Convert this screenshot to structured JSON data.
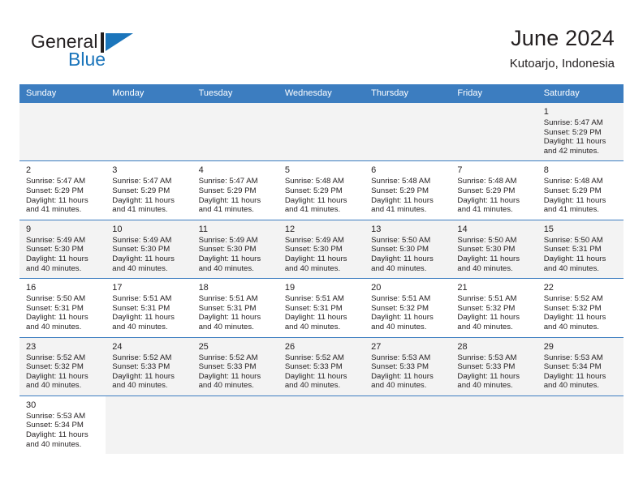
{
  "brand": {
    "name_top": "General",
    "name_bottom": "Blue",
    "accent_color": "#1b75bb",
    "flag_icon": "flag-icon"
  },
  "header": {
    "title": "June 2024",
    "subtitle": "Kutoarjo, Indonesia"
  },
  "calendar": {
    "header_bg": "#3c7dc0",
    "shade_bg": "#f3f3f3",
    "weekdays": [
      "Sunday",
      "Monday",
      "Tuesday",
      "Wednesday",
      "Thursday",
      "Friday",
      "Saturday"
    ],
    "weeks": [
      [
        {
          "empty": true
        },
        {
          "empty": true
        },
        {
          "empty": true
        },
        {
          "empty": true
        },
        {
          "empty": true
        },
        {
          "empty": true
        },
        {
          "day": "1",
          "sunrise": "Sunrise: 5:47 AM",
          "sunset": "Sunset: 5:29 PM",
          "daylight1": "Daylight: 11 hours",
          "daylight2": "and 42 minutes."
        }
      ],
      [
        {
          "day": "2",
          "sunrise": "Sunrise: 5:47 AM",
          "sunset": "Sunset: 5:29 PM",
          "daylight1": "Daylight: 11 hours",
          "daylight2": "and 41 minutes."
        },
        {
          "day": "3",
          "sunrise": "Sunrise: 5:47 AM",
          "sunset": "Sunset: 5:29 PM",
          "daylight1": "Daylight: 11 hours",
          "daylight2": "and 41 minutes."
        },
        {
          "day": "4",
          "sunrise": "Sunrise: 5:47 AM",
          "sunset": "Sunset: 5:29 PM",
          "daylight1": "Daylight: 11 hours",
          "daylight2": "and 41 minutes."
        },
        {
          "day": "5",
          "sunrise": "Sunrise: 5:48 AM",
          "sunset": "Sunset: 5:29 PM",
          "daylight1": "Daylight: 11 hours",
          "daylight2": "and 41 minutes."
        },
        {
          "day": "6",
          "sunrise": "Sunrise: 5:48 AM",
          "sunset": "Sunset: 5:29 PM",
          "daylight1": "Daylight: 11 hours",
          "daylight2": "and 41 minutes."
        },
        {
          "day": "7",
          "sunrise": "Sunrise: 5:48 AM",
          "sunset": "Sunset: 5:29 PM",
          "daylight1": "Daylight: 11 hours",
          "daylight2": "and 41 minutes."
        },
        {
          "day": "8",
          "sunrise": "Sunrise: 5:48 AM",
          "sunset": "Sunset: 5:29 PM",
          "daylight1": "Daylight: 11 hours",
          "daylight2": "and 41 minutes."
        }
      ],
      [
        {
          "day": "9",
          "sunrise": "Sunrise: 5:49 AM",
          "sunset": "Sunset: 5:30 PM",
          "daylight1": "Daylight: 11 hours",
          "daylight2": "and 40 minutes."
        },
        {
          "day": "10",
          "sunrise": "Sunrise: 5:49 AM",
          "sunset": "Sunset: 5:30 PM",
          "daylight1": "Daylight: 11 hours",
          "daylight2": "and 40 minutes."
        },
        {
          "day": "11",
          "sunrise": "Sunrise: 5:49 AM",
          "sunset": "Sunset: 5:30 PM",
          "daylight1": "Daylight: 11 hours",
          "daylight2": "and 40 minutes."
        },
        {
          "day": "12",
          "sunrise": "Sunrise: 5:49 AM",
          "sunset": "Sunset: 5:30 PM",
          "daylight1": "Daylight: 11 hours",
          "daylight2": "and 40 minutes."
        },
        {
          "day": "13",
          "sunrise": "Sunrise: 5:50 AM",
          "sunset": "Sunset: 5:30 PM",
          "daylight1": "Daylight: 11 hours",
          "daylight2": "and 40 minutes."
        },
        {
          "day": "14",
          "sunrise": "Sunrise: 5:50 AM",
          "sunset": "Sunset: 5:30 PM",
          "daylight1": "Daylight: 11 hours",
          "daylight2": "and 40 minutes."
        },
        {
          "day": "15",
          "sunrise": "Sunrise: 5:50 AM",
          "sunset": "Sunset: 5:31 PM",
          "daylight1": "Daylight: 11 hours",
          "daylight2": "and 40 minutes."
        }
      ],
      [
        {
          "day": "16",
          "sunrise": "Sunrise: 5:50 AM",
          "sunset": "Sunset: 5:31 PM",
          "daylight1": "Daylight: 11 hours",
          "daylight2": "and 40 minutes."
        },
        {
          "day": "17",
          "sunrise": "Sunrise: 5:51 AM",
          "sunset": "Sunset: 5:31 PM",
          "daylight1": "Daylight: 11 hours",
          "daylight2": "and 40 minutes."
        },
        {
          "day": "18",
          "sunrise": "Sunrise: 5:51 AM",
          "sunset": "Sunset: 5:31 PM",
          "daylight1": "Daylight: 11 hours",
          "daylight2": "and 40 minutes."
        },
        {
          "day": "19",
          "sunrise": "Sunrise: 5:51 AM",
          "sunset": "Sunset: 5:31 PM",
          "daylight1": "Daylight: 11 hours",
          "daylight2": "and 40 minutes."
        },
        {
          "day": "20",
          "sunrise": "Sunrise: 5:51 AM",
          "sunset": "Sunset: 5:32 PM",
          "daylight1": "Daylight: 11 hours",
          "daylight2": "and 40 minutes."
        },
        {
          "day": "21",
          "sunrise": "Sunrise: 5:51 AM",
          "sunset": "Sunset: 5:32 PM",
          "daylight1": "Daylight: 11 hours",
          "daylight2": "and 40 minutes."
        },
        {
          "day": "22",
          "sunrise": "Sunrise: 5:52 AM",
          "sunset": "Sunset: 5:32 PM",
          "daylight1": "Daylight: 11 hours",
          "daylight2": "and 40 minutes."
        }
      ],
      [
        {
          "day": "23",
          "sunrise": "Sunrise: 5:52 AM",
          "sunset": "Sunset: 5:32 PM",
          "daylight1": "Daylight: 11 hours",
          "daylight2": "and 40 minutes."
        },
        {
          "day": "24",
          "sunrise": "Sunrise: 5:52 AM",
          "sunset": "Sunset: 5:33 PM",
          "daylight1": "Daylight: 11 hours",
          "daylight2": "and 40 minutes."
        },
        {
          "day": "25",
          "sunrise": "Sunrise: 5:52 AM",
          "sunset": "Sunset: 5:33 PM",
          "daylight1": "Daylight: 11 hours",
          "daylight2": "and 40 minutes."
        },
        {
          "day": "26",
          "sunrise": "Sunrise: 5:52 AM",
          "sunset": "Sunset: 5:33 PM",
          "daylight1": "Daylight: 11 hours",
          "daylight2": "and 40 minutes."
        },
        {
          "day": "27",
          "sunrise": "Sunrise: 5:53 AM",
          "sunset": "Sunset: 5:33 PM",
          "daylight1": "Daylight: 11 hours",
          "daylight2": "and 40 minutes."
        },
        {
          "day": "28",
          "sunrise": "Sunrise: 5:53 AM",
          "sunset": "Sunset: 5:33 PM",
          "daylight1": "Daylight: 11 hours",
          "daylight2": "and 40 minutes."
        },
        {
          "day": "29",
          "sunrise": "Sunrise: 5:53 AM",
          "sunset": "Sunset: 5:34 PM",
          "daylight1": "Daylight: 11 hours",
          "daylight2": "and 40 minutes."
        }
      ],
      [
        {
          "day": "30",
          "sunrise": "Sunrise: 5:53 AM",
          "sunset": "Sunset: 5:34 PM",
          "daylight1": "Daylight: 11 hours",
          "daylight2": "and 40 minutes."
        },
        {
          "empty": true
        },
        {
          "empty": true
        },
        {
          "empty": true
        },
        {
          "empty": true
        },
        {
          "empty": true
        },
        {
          "empty": true
        }
      ]
    ]
  }
}
